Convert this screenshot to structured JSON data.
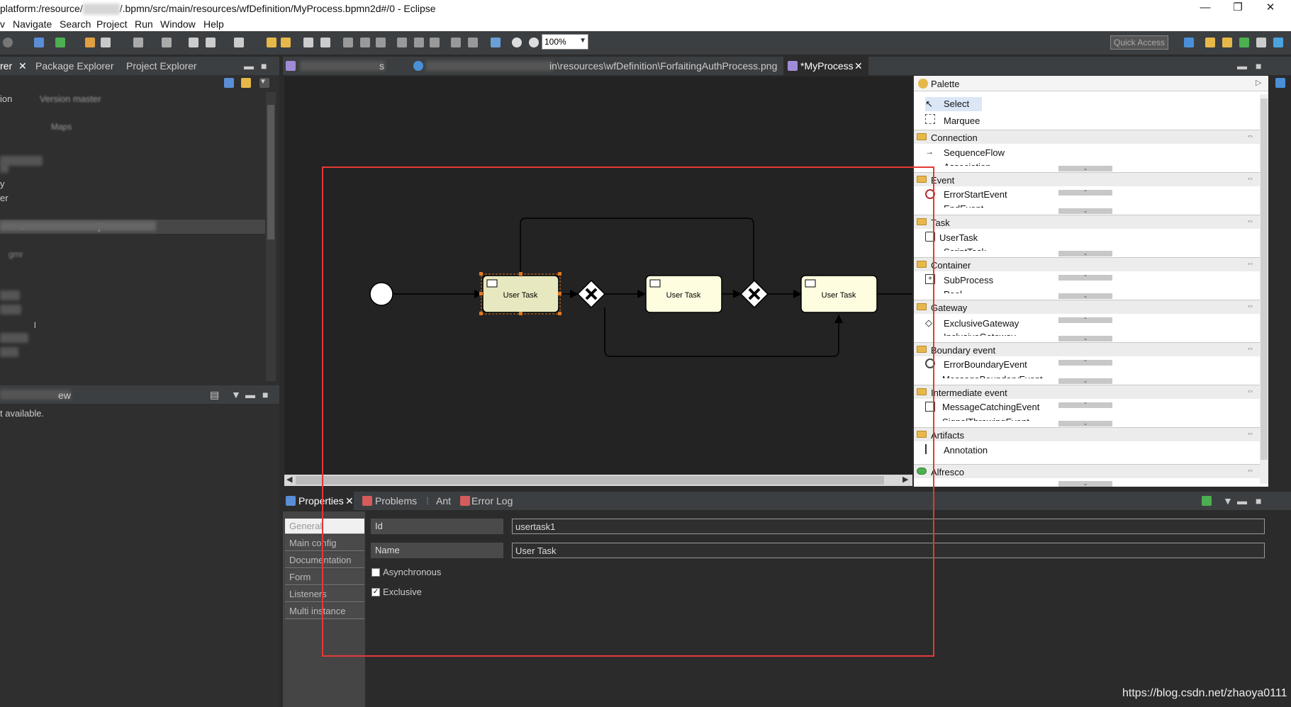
{
  "window": {
    "title_prefix": "platform:/resource/",
    "title_suffix": "/.bpmn/src/main/resources/wfDefinition/MyProcess.bpmn2d#/0 - Eclipse",
    "controls": [
      "—",
      "❐",
      "✕"
    ]
  },
  "menu": [
    "Navigate",
    "Search",
    "Project",
    "Run",
    "Window",
    "Help"
  ],
  "toolbar": {
    "zoom_value": "100%",
    "quick_access": "Quick Access"
  },
  "left": {
    "tabs": [
      {
        "label": "rer"
      },
      {
        "label": "Package Explorer"
      },
      {
        "label": "Project Explorer"
      }
    ],
    "lines": [
      "ion",
      "Version master",
      "Maps",
      "y",
      "er",
      "o",
      "]",
      "gmr",
      "l"
    ],
    "bottom_tab": "ew",
    "bottom_message": "t available."
  },
  "editor": {
    "tabs": [
      {
        "label": "s"
      },
      {
        "label": "in\\resources\\wfDefinition\\ForfaitingAuthProcess.png"
      },
      {
        "label": "*MyProcess"
      }
    ],
    "tasks": [
      {
        "label": "User Task"
      },
      {
        "label": "User Task"
      },
      {
        "label": "User Task"
      }
    ]
  },
  "palette": {
    "title": "Palette",
    "tools": [
      "Select",
      "Marquee"
    ],
    "drawers": [
      {
        "label": "Connection",
        "items": [
          "SequenceFlow",
          "Association"
        ]
      },
      {
        "label": "Event",
        "items": [
          "ErrorStartEvent",
          "EndEvent"
        ]
      },
      {
        "label": "Task",
        "items": [
          "UserTask",
          "ScriptTask"
        ]
      },
      {
        "label": "Container",
        "items": [
          "SubProcess",
          "Pool"
        ]
      },
      {
        "label": "Gateway",
        "items": [
          "ExclusiveGateway",
          "InclusiveGateway"
        ]
      },
      {
        "label": "Boundary event",
        "items": [
          "ErrorBoundaryEvent",
          "MessageBoundaryEvent"
        ]
      },
      {
        "label": "Intermediate event",
        "items": [
          "MessageCatchingEvent",
          "SignalThrowingEvent"
        ]
      },
      {
        "label": "Artifacts",
        "items": [
          "Annotation"
        ]
      },
      {
        "label": "Alfresco",
        "items": []
      }
    ]
  },
  "properties": {
    "tabs": [
      "Properties",
      "Problems",
      "Ant",
      "Error Log"
    ],
    "sections": [
      "General",
      "Main config",
      "Documentation",
      "Form",
      "Listeners",
      "Multi instance"
    ],
    "id_label": "Id",
    "id_value": "usertask1",
    "name_label": "Name",
    "name_value": "User Task",
    "async_label": "Asynchronous",
    "exclusive_label": "Exclusive",
    "check_mark": "✓"
  },
  "watermark": "https://blog.csdn.net/zhaoya0111"
}
